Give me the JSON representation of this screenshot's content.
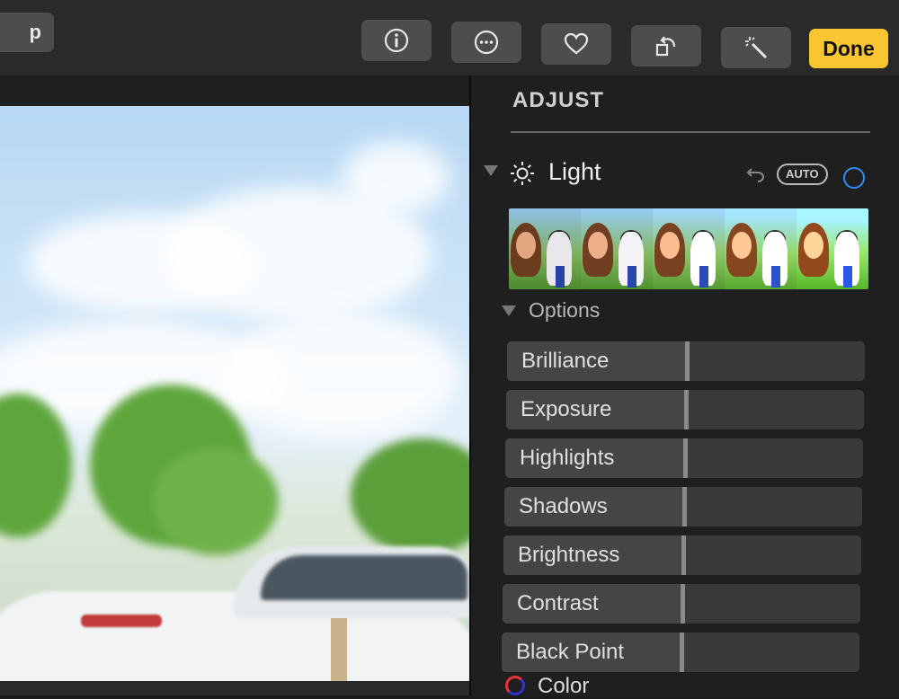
{
  "toolbar": {
    "back_label": "p",
    "buttons": [
      {
        "name": "info-button",
        "icon": "info-icon"
      },
      {
        "name": "more-button",
        "icon": "ellipsis-icon"
      },
      {
        "name": "favorite-button",
        "icon": "heart-icon"
      },
      {
        "name": "rotate-button",
        "icon": "rotate-icon"
      },
      {
        "name": "enhance-button",
        "icon": "magic-wand-icon"
      }
    ],
    "done_label": "Done",
    "done_color": "#f9c632"
  },
  "panel": {
    "title": "ADJUST",
    "light": {
      "label": "Light",
      "auto_label": "AUTO",
      "enabled_color": "#2b8ef2",
      "thumbnail_count": 5
    },
    "options_label": "Options",
    "sliders": [
      {
        "label": "Brilliance",
        "value": 0.5
      },
      {
        "label": "Exposure",
        "value": 0.5
      },
      {
        "label": "Highlights",
        "value": 0.5
      },
      {
        "label": "Shadows",
        "value": 0.5
      },
      {
        "label": "Brightness",
        "value": 0.5
      },
      {
        "label": "Contrast",
        "value": 0.5
      },
      {
        "label": "Black Point",
        "value": 0.5
      }
    ],
    "color_label": "Color"
  }
}
